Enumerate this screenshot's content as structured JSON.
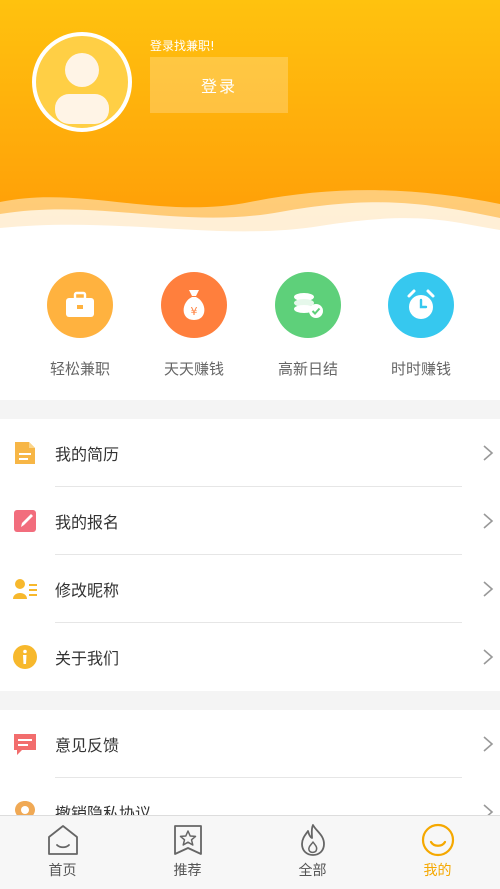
{
  "header": {
    "login_hint": "登录找兼职!",
    "login_button": "登录"
  },
  "quick_actions": [
    {
      "label": "轻松兼职",
      "icon": "briefcase-icon",
      "color": "#ffb23f"
    },
    {
      "label": "天天赚钱",
      "icon": "money-bag-icon",
      "color": "#ff7f3d"
    },
    {
      "label": "高新日结",
      "icon": "coins-icon",
      "color": "#5ed07a"
    },
    {
      "label": "时时赚钱",
      "icon": "clock-icon",
      "color": "#36c8ef"
    }
  ],
  "menu_main": [
    {
      "label": "我的简历",
      "icon": "document-icon",
      "color": "#f7b646"
    },
    {
      "label": "我的报名",
      "icon": "edit-icon",
      "color": "#f26d7d"
    },
    {
      "label": "修改昵称",
      "icon": "user-list-icon",
      "color": "#f7b82c"
    },
    {
      "label": "关于我们",
      "icon": "info-icon",
      "color": "#f7b82c"
    }
  ],
  "menu_secondary": [
    {
      "label": "意见反馈",
      "icon": "feedback-icon",
      "color": "#f26d6d"
    },
    {
      "label": "撤销隐私协议",
      "icon": "location-icon",
      "color": "#f0a955"
    }
  ],
  "tabs": [
    {
      "label": "首页",
      "icon": "home-icon",
      "active": false
    },
    {
      "label": "推荐",
      "icon": "star-icon",
      "active": false
    },
    {
      "label": "全部",
      "icon": "flame-icon",
      "active": false
    },
    {
      "label": "我的",
      "icon": "smile-icon",
      "active": true
    }
  ],
  "colors": {
    "brand_orange": "#ffb00c",
    "tab_active": "#f5a800"
  }
}
